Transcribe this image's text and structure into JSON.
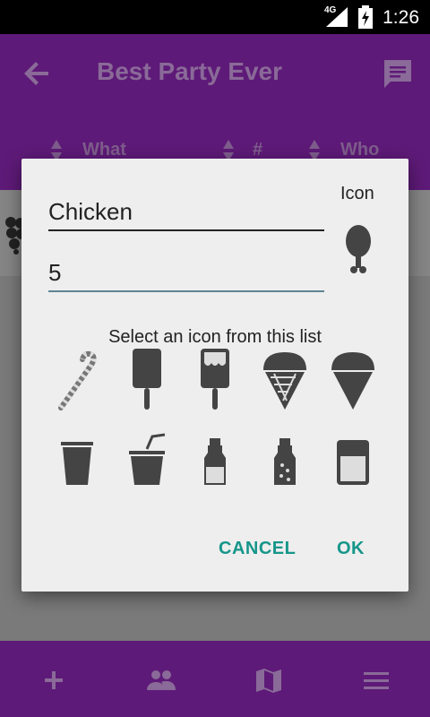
{
  "status_bar": {
    "network": "4G",
    "time": "1:26"
  },
  "app_bar": {
    "title": "Best Party Ever"
  },
  "columns": {
    "what": "What",
    "count": "#",
    "who": "Who"
  },
  "dialog": {
    "name_value": "Chicken",
    "quantity_value": "5",
    "icon_label": "Icon",
    "hint": "Select an icon from this list",
    "cancel_label": "CANCEL",
    "ok_label": "OK",
    "icons": [
      "candy-cane-icon",
      "popsicle-icon",
      "dipped-popsicle-icon",
      "waffle-cone-icon",
      "snow-cone-icon",
      "cup-icon",
      "soda-straw-icon",
      "milk-bottle-icon",
      "flavored-milk-bottle-icon",
      "jar-icon"
    ]
  },
  "bottom_nav": [
    "add-icon",
    "people-icon",
    "map-icon",
    "menu-icon"
  ],
  "colors": {
    "primary": "#5e1a78",
    "accent": "#16968a",
    "dialog_bg": "#eeeeee"
  }
}
